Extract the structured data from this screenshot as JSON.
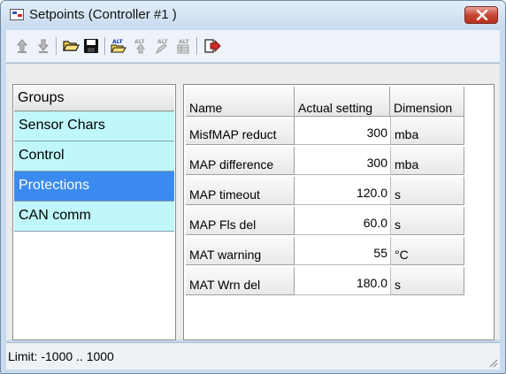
{
  "window": {
    "title": "Setpoints (Controller #1 )",
    "accent_color": "#3a8af0",
    "close_color": "#c74936"
  },
  "toolbar": {
    "buttons": [
      {
        "name": "upload-icon"
      },
      {
        "name": "download-icon"
      },
      {
        "name": "open-folder-icon"
      },
      {
        "name": "save-icon"
      },
      {
        "name": "alt-open-icon"
      },
      {
        "name": "alt-upload-icon"
      },
      {
        "name": "alt-edit-icon"
      },
      {
        "name": "alt-table-icon"
      },
      {
        "name": "export-icon"
      }
    ]
  },
  "groups": {
    "header": "Groups",
    "items": [
      {
        "label": "Sensor Chars",
        "selected": false
      },
      {
        "label": "Control",
        "selected": false
      },
      {
        "label": "Protections",
        "selected": true
      },
      {
        "label": "CAN comm",
        "selected": false
      }
    ]
  },
  "grid": {
    "columns": [
      "Name",
      "Actual setting",
      "Dimension"
    ],
    "rows": [
      {
        "name": "MisfMAP reduct",
        "value": "300",
        "unit": "mba"
      },
      {
        "name": "MAP difference",
        "value": "300",
        "unit": "mba"
      },
      {
        "name": "MAP timeout",
        "value": "120.0",
        "unit": "s"
      },
      {
        "name": "MAP Fls del",
        "value": "60.0",
        "unit": "s"
      },
      {
        "name": "MAT warning",
        "value": "55",
        "unit": "°C"
      },
      {
        "name": "MAT Wrn del",
        "value": "180.0",
        "unit": "s"
      }
    ]
  },
  "status": {
    "text": "Limit: -1000 .. 1000"
  }
}
